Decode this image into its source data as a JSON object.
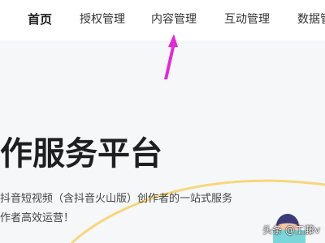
{
  "nav": {
    "items": [
      {
        "label": "首页",
        "active": true
      },
      {
        "label": "授权管理",
        "active": false
      },
      {
        "label": "内容管理",
        "active": false
      },
      {
        "label": "互动管理",
        "active": false
      },
      {
        "label": "数据管"
      }
    ]
  },
  "hero": {
    "title": "作服务平台",
    "subtitle_line1": "抖音短视频（含抖音火山版）创作者的一站式服务",
    "subtitle_line2": "作者高效运营！"
  },
  "watermark": "头条 @工藤v",
  "colors": {
    "annotation_arrow": "#e02ad6",
    "decor_curve": "#f6d77a",
    "background": "#f6f7f9"
  }
}
